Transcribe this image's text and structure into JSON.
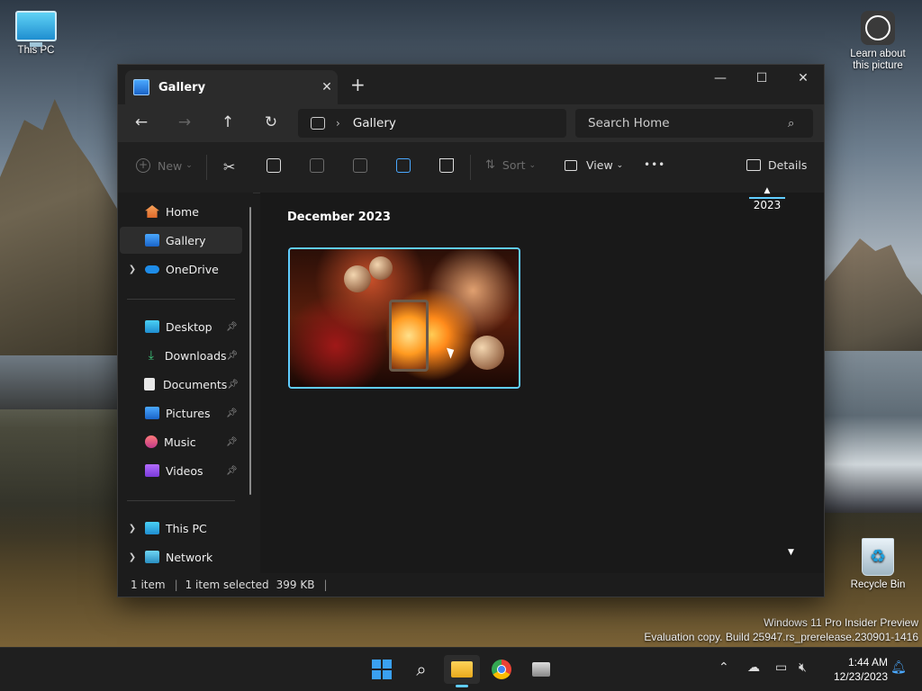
{
  "desktop": {
    "this_pc": "This PC",
    "learn_line1": "Learn about",
    "learn_line2": "this picture",
    "recycle_bin": "Recycle Bin",
    "watermark_line1": "Windows 11 Pro Insider Preview",
    "watermark_line2": "Evaluation copy. Build 25947.rs_prerelease.230901-1416"
  },
  "window": {
    "tab_title": "Gallery",
    "tab_close": "✕",
    "new_tab": "+",
    "minimize": "—",
    "maximize": "☐",
    "close": "✕"
  },
  "nav": {
    "back": "←",
    "forward": "→",
    "up": "↑",
    "refresh": "↻",
    "breadcrumb": "Gallery",
    "search_placeholder": "Search Home"
  },
  "toolbar": {
    "new_label": "New",
    "sort_label": "Sort",
    "view_label": "View",
    "more_label": "•••",
    "details_label": "Details"
  },
  "sidebar": {
    "items": [
      {
        "label": "Home"
      },
      {
        "label": "Gallery"
      },
      {
        "label": "OneDrive"
      },
      {
        "label": "Desktop"
      },
      {
        "label": "Downloads"
      },
      {
        "label": "Documents"
      },
      {
        "label": "Pictures"
      },
      {
        "label": "Music"
      },
      {
        "label": "Videos"
      },
      {
        "label": "This PC"
      },
      {
        "label": "Network"
      }
    ]
  },
  "content": {
    "group_header": "December 2023",
    "year": "2023"
  },
  "status": {
    "count": "1 item",
    "selected": "1 item selected",
    "size": "399 KB"
  },
  "taskbar": {
    "time": "1:44 AM",
    "date": "12/23/2023"
  }
}
